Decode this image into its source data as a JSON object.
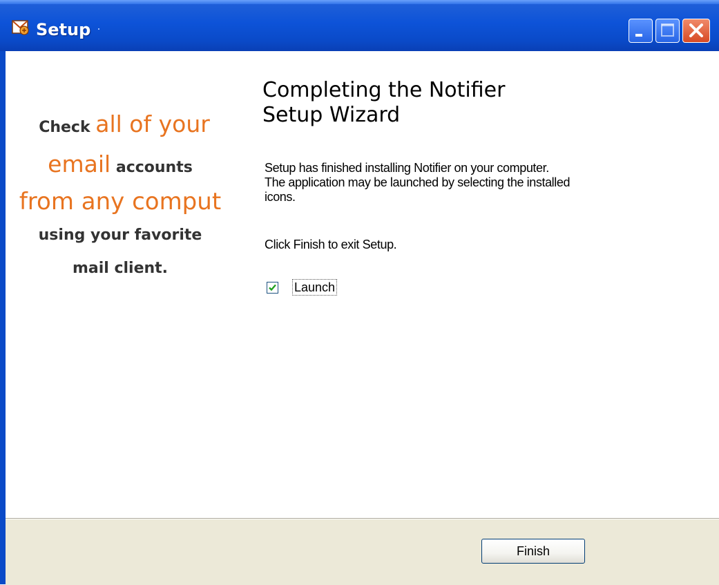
{
  "window": {
    "title": "Setup",
    "title_suffix": "·"
  },
  "promo": {
    "line1_a": "Check ",
    "line1_b": "all of your",
    "line2_a": "email",
    "line2_b": " accounts",
    "line3": "from any comput",
    "line4": "using your favorite",
    "line5": "mail client."
  },
  "main": {
    "heading_line1": "Completing the Notifier",
    "heading_line2": "Setup Wizard",
    "body_line1": "Setup has finished installing Notifier on your computer.",
    "body_line2": "The application may be launched by selecting the installed",
    "body_line3": "icons.",
    "instruction": "Click Finish to exit Setup.",
    "launch_label": "Launch",
    "launch_checked": true
  },
  "footer": {
    "finish_label": "Finish"
  },
  "colors": {
    "titlebar": "#0a4ac8",
    "promo_orange": "#e87420",
    "panel_bg": "#ece9d8"
  }
}
